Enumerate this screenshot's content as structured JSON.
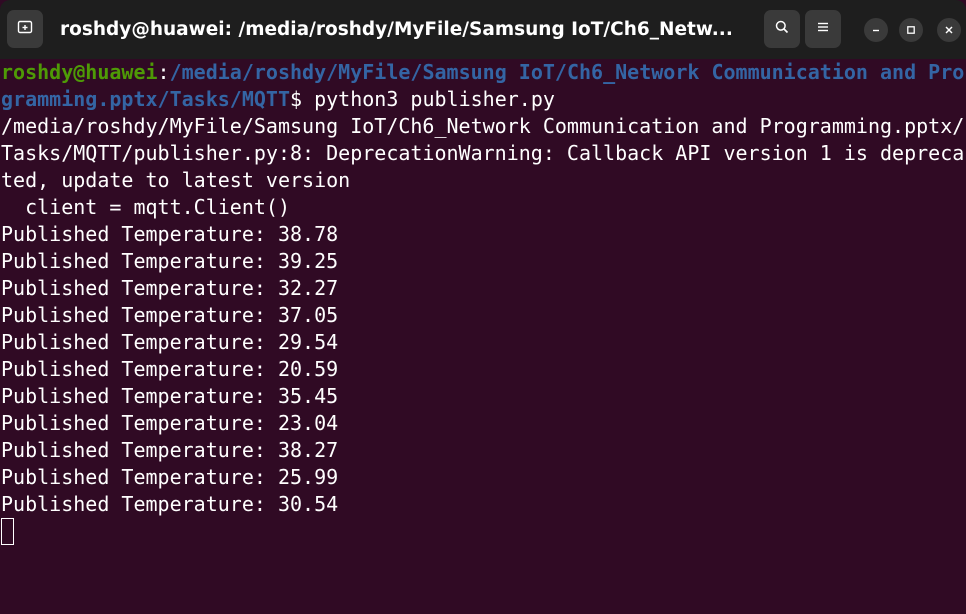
{
  "window": {
    "title": "roshdy@huawei: /media/roshdy/MyFile/Samsung IoT/Ch6_Netw..."
  },
  "header_buttons": {
    "new_tab_icon": "new-tab-icon",
    "search_icon": "search-icon",
    "menu_icon": "hamburger-menu-icon",
    "minimize_icon": "minimize-icon",
    "maximize_icon": "maximize-icon",
    "close_icon": "close-icon"
  },
  "colors": {
    "terminal_bg": "#300a24",
    "titlebar_bg": "#1e1e1e",
    "prompt_user": "#4e9a06",
    "prompt_path": "#3465a4",
    "text": "#ffffff"
  },
  "terminal": {
    "prompt": {
      "user_host": "roshdy@huawei",
      "colon": ":",
      "path_line1": "/media/roshdy/MyFile/Samsung IoT/Ch6_Network Communication and Pro",
      "path_line2": "gramming.pptx/Tasks/MQTT",
      "dollar": "$ ",
      "command": "python3 publisher.py"
    },
    "output": [
      "/media/roshdy/MyFile/Samsung IoT/Ch6_Network Communication and Programming.pptx/",
      "Tasks/MQTT/publisher.py:8: DeprecationWarning: Callback API version 1 is depreca",
      "ted, update to latest version",
      "  client = mqtt.Client()",
      "Published Temperature: 38.78",
      "Published Temperature: 39.25",
      "Published Temperature: 32.27",
      "Published Temperature: 37.05",
      "Published Temperature: 29.54",
      "Published Temperature: 20.59",
      "Published Temperature: 35.45",
      "Published Temperature: 23.04",
      "Published Temperature: 38.27",
      "Published Temperature: 25.99",
      "Published Temperature: 30.54"
    ]
  }
}
